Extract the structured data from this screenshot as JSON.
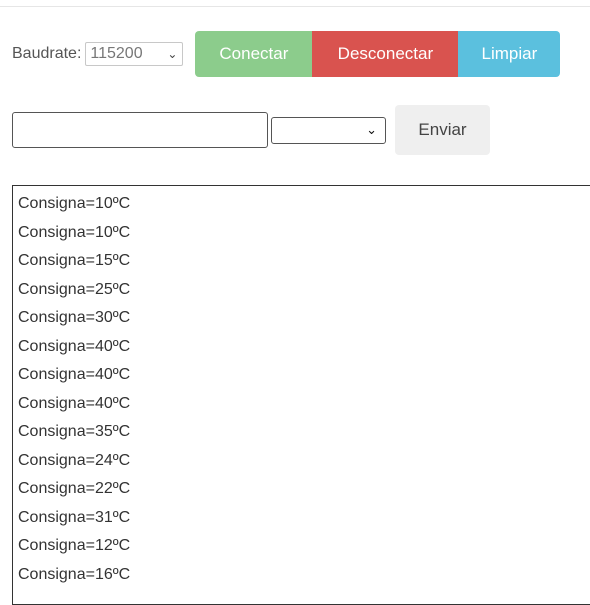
{
  "controls": {
    "baudrate_label": "Baudrate:",
    "baudrate_value": "115200",
    "connect_label": "Conectar",
    "disconnect_label": "Desconectar",
    "clear_label": "Limpiar"
  },
  "sender": {
    "input_value": "",
    "line_ending_value": "",
    "send_label": "Enviar"
  },
  "output": {
    "lines": [
      "Consigna=10ºC",
      "Consigna=10ºC",
      "Consigna=15ºC",
      "Consigna=25ºC",
      "Consigna=30ºC",
      "Consigna=40ºC",
      "Consigna=40ºC",
      "Consigna=40ºC",
      "Consigna=35ºC",
      "Consigna=24ºC",
      "Consigna=22ºC",
      "Consigna=31ºC",
      "Consigna=12ºC",
      "Consigna=16ºC"
    ]
  },
  "colors": {
    "connect": "#8ccc8c",
    "disconnect": "#d9534f",
    "clear": "#5bc0de",
    "send": "#efefef"
  },
  "icons": {
    "select_arrow": "chevron-down-icon"
  }
}
